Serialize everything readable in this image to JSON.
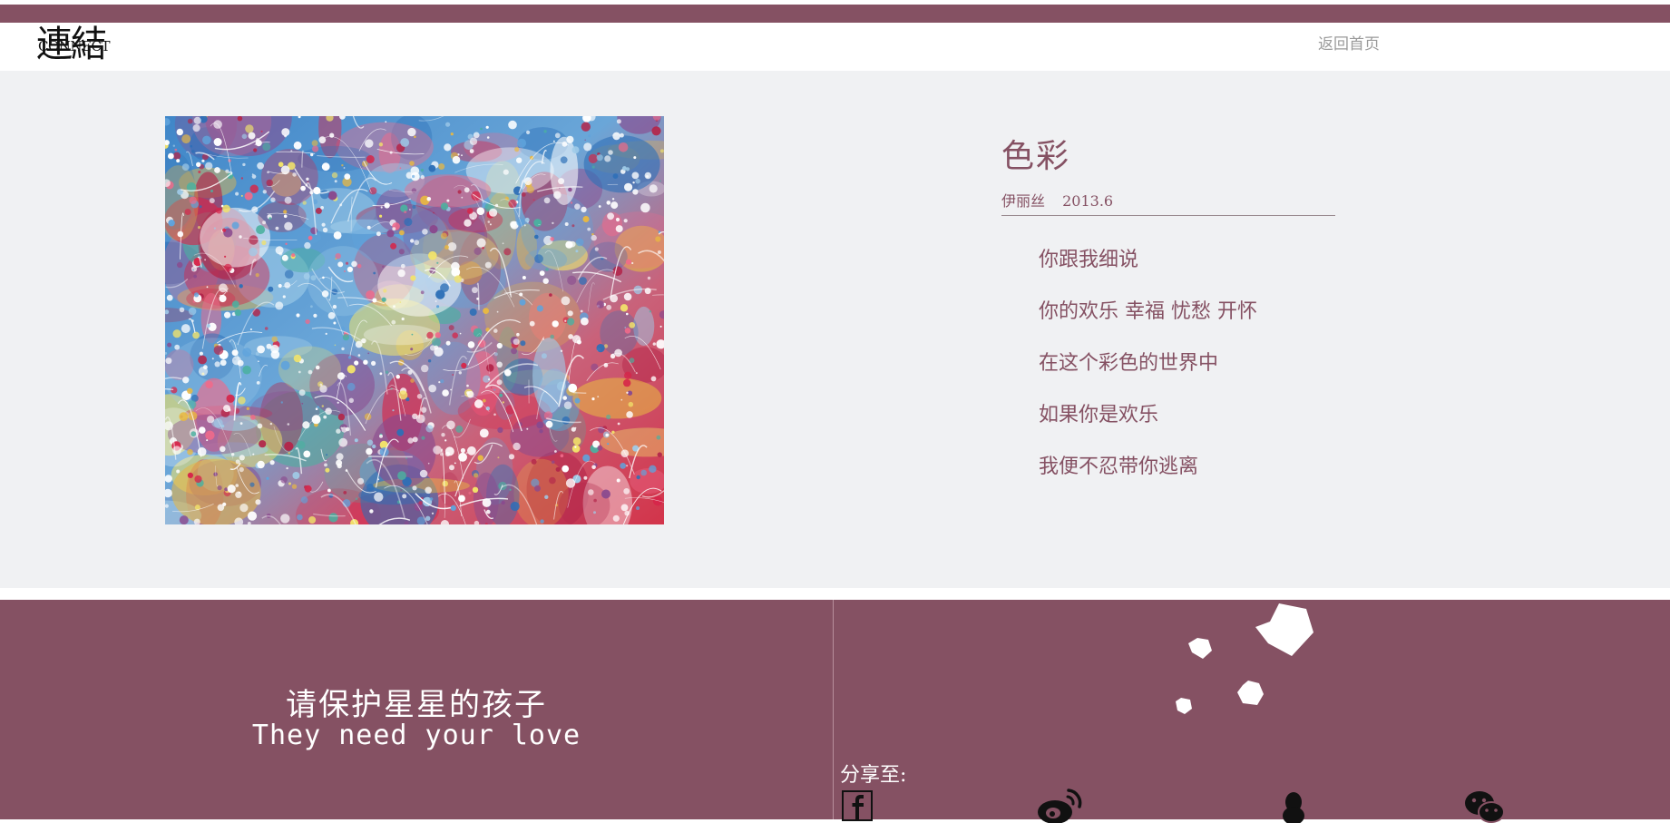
{
  "brand": {
    "logo_cn": "連結",
    "logo_en": "CONNECT"
  },
  "nav": {
    "home_label": "返回首页"
  },
  "poem": {
    "title": "色彩",
    "author": "伊丽丝",
    "date": "2013.6",
    "lines": [
      "你跟我细说",
      "你的欢乐 幸福 忧愁 开怀",
      "在这个彩色的世界中",
      "如果你是欢乐",
      "我便不忍带你逃离"
    ]
  },
  "footer": {
    "slogan_cn": "请保护星星的孩子",
    "slogan_en": "They need your love",
    "share_label": "分享至:",
    "share_icons": [
      "facebook-icon",
      "weibo-icon",
      "qq-icon",
      "wechat-icon"
    ]
  },
  "colors": {
    "accent": "#855163",
    "content_bg": "#f0f1f3",
    "muted_text": "#9a9a9a"
  }
}
